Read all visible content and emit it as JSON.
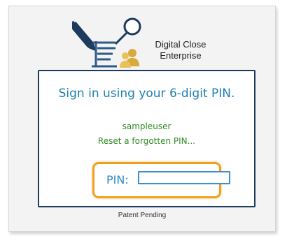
{
  "brand": {
    "line1": "Digital Close",
    "line2": "Enterprise"
  },
  "signin": {
    "heading": "Sign in using your 6-digit PIN.",
    "username": "sampleuser",
    "reset_link": "Reset a forgotten PIN...",
    "pin_label": "PIN:",
    "pin_value": ""
  },
  "footer": {
    "text": "Patent Pending"
  },
  "colors": {
    "card_border": "#1c3b5e",
    "heading": "#1f7fb0",
    "link_green": "#2e8b22",
    "highlight": "#f0a020",
    "input_border": "#3a8fd0"
  },
  "icons": [
    "pen-document-logo-icon",
    "magnifier-icon",
    "users-icon"
  ]
}
